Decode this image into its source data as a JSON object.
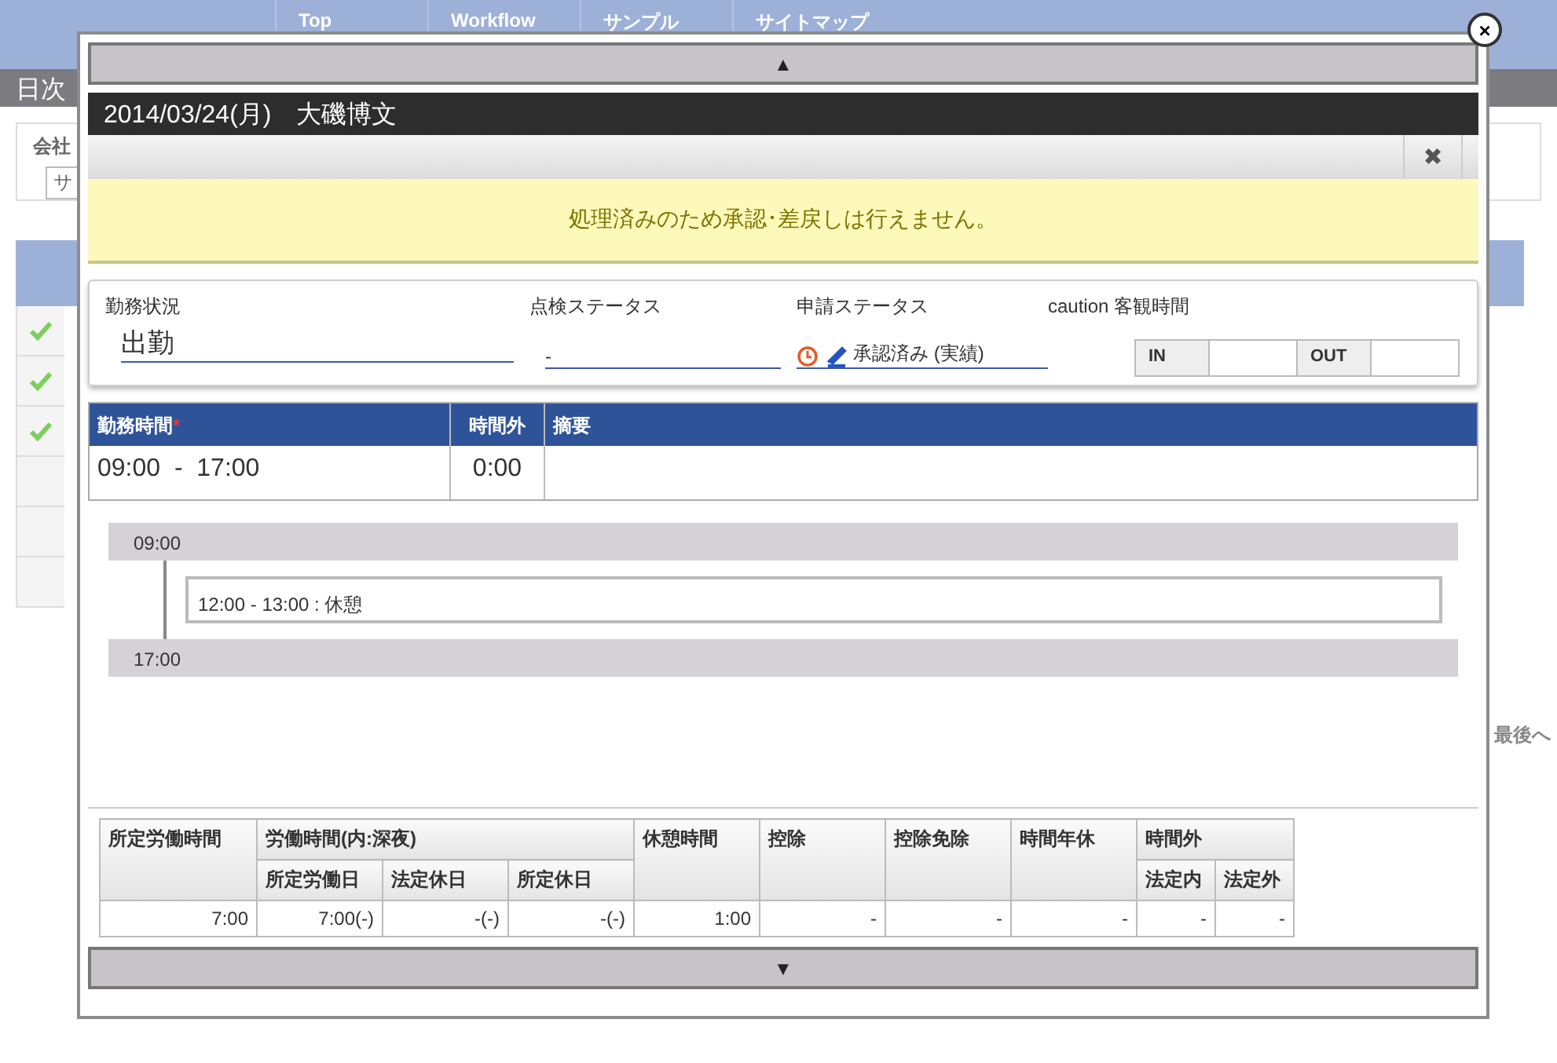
{
  "background": {
    "nav": [
      "Top",
      "Workflow",
      "サンプル",
      "サイトマップ"
    ],
    "page_title": "日次",
    "company_label": "会社",
    "company_value": "サ",
    "rows": [
      {
        "checked": true
      },
      {
        "checked": true
      },
      {
        "checked": true
      },
      {
        "checked": false
      },
      {
        "checked": false
      },
      {
        "checked": false
      }
    ],
    "last_link": "最後へ"
  },
  "dialog": {
    "up": "▲",
    "title": "2014/03/24(月)　大磯博文",
    "close": "✖",
    "message": "処理済みのため承認･差戻しは行えません。",
    "close_overlay": "×",
    "status": {
      "work_label": "勤務状況",
      "work_value": "出勤",
      "check_label": "点検ステータス",
      "check_value": "-",
      "apply_label": "申請ステータス",
      "apply_value": "承認済み (実績)",
      "objective_label": "caution 客観時間",
      "in_label": "IN",
      "out_label": "OUT"
    },
    "work_table": {
      "columns": [
        {
          "label": "勤務時間",
          "required": true
        },
        {
          "label": "時間外",
          "required": false
        },
        {
          "label": "摘要",
          "required": false
        }
      ],
      "required_mark": "*",
      "start": "09:00",
      "separator": "-",
      "end": "17:00",
      "overtime": "0:00"
    },
    "timeline": {
      "start": "09:00",
      "breaks": [
        "12:00 - 13:00 : 休憩"
      ],
      "end": "17:00"
    },
    "summary": {
      "groups": [
        {
          "label": "所定労働時間"
        },
        {
          "label": "労働時間(内:深夜)",
          "subs": [
            "所定労働日",
            "法定休日",
            "所定休日"
          ]
        },
        {
          "label": "休憩時間"
        },
        {
          "label": "控除"
        },
        {
          "label": "控除免除"
        },
        {
          "label": "時間年休"
        },
        {
          "label": "時間外",
          "subs": [
            "法定内",
            "法定外"
          ]
        }
      ],
      "values": [
        "7:00",
        "7:00(-)",
        "-(-)",
        "-(-)",
        "1:00",
        "-",
        "-",
        "-",
        "-",
        "-"
      ]
    },
    "down": "▼"
  }
}
